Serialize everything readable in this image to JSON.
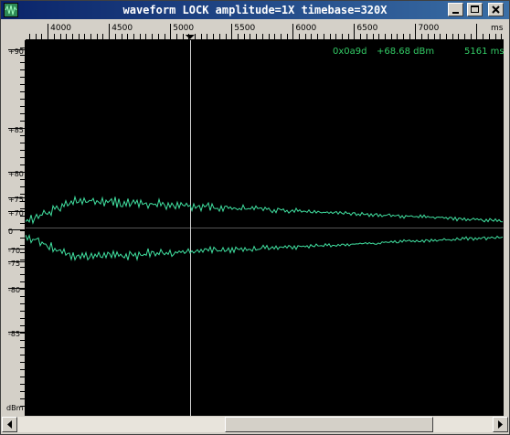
{
  "window": {
    "title": "waveform  LOCK amplitude=1X timebase=320X",
    "controls": {
      "minimize": "minimize-icon",
      "maximize": "maximize-icon",
      "close": "close-icon"
    }
  },
  "top_ruler": {
    "ticks": [
      {
        "label": "4000",
        "value": 4000
      },
      {
        "label": "4500",
        "value": 4500
      },
      {
        "label": "5000",
        "value": 5000
      },
      {
        "label": "5500",
        "value": 5500
      },
      {
        "label": "6000",
        "value": 6000
      },
      {
        "label": "6500",
        "value": 6500
      },
      {
        "label": "7000",
        "value": 7000
      }
    ],
    "unit": "ms",
    "range": [
      3820,
      7720
    ],
    "cursor_value": 5161
  },
  "left_ruler": {
    "ticks": [
      "+90",
      "+85",
      "+80",
      "+75",
      "+70",
      "0",
      "-70",
      "-75",
      "-80",
      "-85"
    ],
    "unit": "dBm"
  },
  "readout": {
    "hex": "0x0a9d",
    "level": "+68.68 dBm",
    "time": "5161 ms"
  },
  "colors": {
    "trace": "#40e0a0",
    "readout": "#33cc66",
    "background": "#000000",
    "crosshair": "#cfcfcf",
    "titlebar": "#0a246a"
  },
  "scrollbar": {
    "left_icon": "arrow-left-icon",
    "right_icon": "arrow-right-icon",
    "thumb_position": 0.5
  }
}
